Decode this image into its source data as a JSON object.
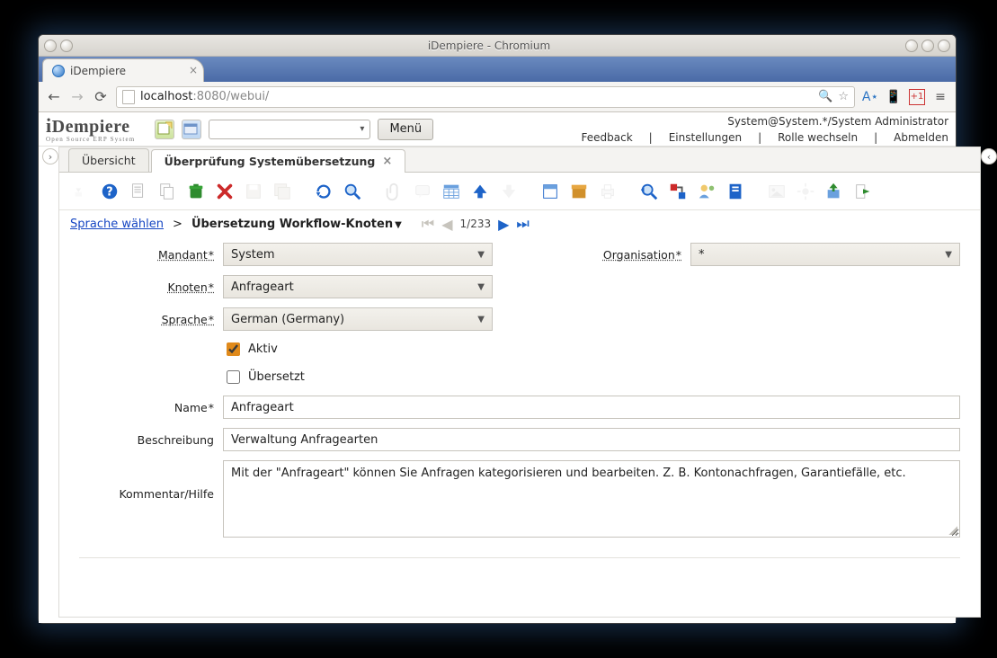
{
  "os": {
    "title": "iDempiere - Chromium"
  },
  "browser": {
    "tab_title": "iDempiere",
    "url_display_host": "localhost",
    "url_display_rest": ":8080/webui/"
  },
  "header": {
    "logo_main": "iDempiere",
    "logo_sub": "Open Source   ERP System",
    "menu_button": "Menü",
    "user_line": "System@System.*/System Administrator",
    "links": {
      "feedback": "Feedback",
      "settings": "Einstellungen",
      "switch_role": "Rolle wechseln",
      "logout": "Abmelden"
    }
  },
  "apptabs": {
    "overview": "Übersicht",
    "active": "Überprüfung Systemübersetzung"
  },
  "breadcrumb": {
    "link": "Sprache wählen",
    "sep": ">",
    "current": "Übersetzung Workflow-Knoten",
    "page": "1/233"
  },
  "form": {
    "labels": {
      "mandant": "Mandant",
      "organisation": "Organisation",
      "knoten": "Knoten",
      "sprache": "Sprache",
      "aktiv": "Aktiv",
      "uebersetzt": "Übersetzt",
      "name": "Name",
      "beschreibung": "Beschreibung",
      "kommentar": "Kommentar/Hilfe"
    },
    "values": {
      "mandant": "System",
      "organisation": "*",
      "knoten": "Anfrageart",
      "sprache": "German (Germany)",
      "aktiv": true,
      "uebersetzt": false,
      "name": "Anfrageart",
      "beschreibung": "Verwaltung Anfragearten",
      "kommentar": "Mit der \"Anfrageart\" können Sie Anfragen kategorisieren und bearbeiten.  Z. B. Kontonachfragen, Garantiefälle, etc."
    }
  },
  "icons": {
    "help": "help-icon",
    "new": "new-doc-icon",
    "copy": "copy-icon",
    "trash": "trash-icon",
    "delete": "delete-x-icon",
    "save": "save-icon",
    "saveall": "saveall-icon",
    "refresh": "refresh-icon",
    "search": "search-icon",
    "attach": "paperclip-icon",
    "chat": "chat-icon",
    "grid": "grid-icon",
    "up": "arrow-up-icon",
    "down": "arrow-down-icon",
    "detail": "detail-icon",
    "archive": "archive-icon",
    "print": "print-icon",
    "zoom": "zoom-icon",
    "process": "process-icon",
    "workflow": "workflow-icon",
    "report": "report-icon",
    "image": "image-icon",
    "gear": "gear-icon",
    "export": "export-icon",
    "exit": "exit-icon"
  }
}
